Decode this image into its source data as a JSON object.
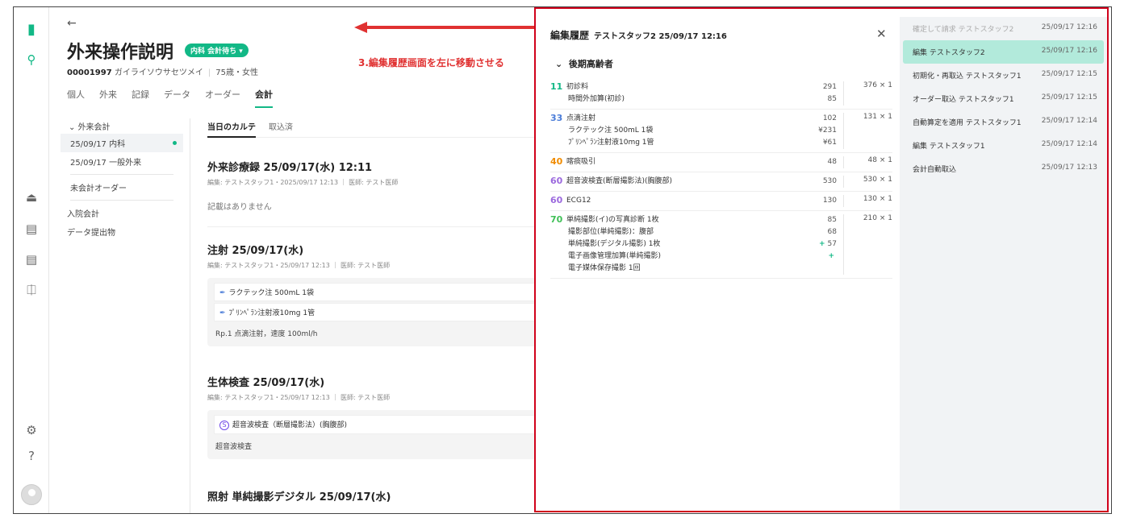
{
  "annotation": "3.編集履歴画面を左に移動させる",
  "patient": {
    "name": "外来操作説明",
    "badge": "内科 会計待ち ▾",
    "id": "00001997",
    "kana": "ガイライソウサセツメイ",
    "age_sex": "75歳・女性"
  },
  "tabs": [
    "個人",
    "外来",
    "記録",
    "データ",
    "オーダー",
    "会計"
  ],
  "subnav": {
    "group": "外来会計",
    "visits": [
      "25/09/17 内科",
      "25/09/17 一般外来"
    ],
    "unpaid": "未会計オーダー",
    "inpatient": "入院会計",
    "submissions": "データ提出物"
  },
  "main": {
    "tabs": [
      "当日のカルテ",
      "取込済"
    ],
    "records": [
      {
        "title": "外来診療録  25/09/17(水) 12:11",
        "meta": "編集: テストスタッフ1・2025/09/17 12:13 ｜ 医師: テスト医師",
        "empty": "記載はありません"
      },
      {
        "title": "注射  25/09/17(水)",
        "meta": "編集: テストスタッフ1・25/09/17 12:13 ｜ 医師: テスト医師",
        "lines": [
          "ラクテック注 500mL  1袋",
          "ﾌﾟﾘﾝﾍﾟﾗﾝ注射液10mg  1管"
        ],
        "rp": "Rp.1  点滴注射，速度 100ml/h"
      },
      {
        "title": "生体検査  25/09/17(水)",
        "meta": "編集: テストスタッフ1・25/09/17 12:13 ｜ 医師: テスト医師",
        "line": "超音波検査（断層撮影法）(胸腹部)",
        "rp": "超音波検査"
      },
      {
        "title": "照射 単純撮影デジタル  25/09/17(水)"
      }
    ]
  },
  "edit_panel": {
    "title": "編集履歴",
    "who": "テストスタッフ2  25/09/17 12:16",
    "group": "後期高齢者",
    "rows": [
      {
        "code": "11",
        "color": "#12b886",
        "items": [
          "初診料",
          "時間外加算(初診)"
        ],
        "points": [
          "291",
          "85"
        ],
        "total": "376 × 1"
      },
      {
        "code": "33",
        "color": "#4a7cd8",
        "items": [
          "点滴注射",
          "ラクテック注 500mL  1袋",
          "ﾌﾟﾘﾝﾍﾟﾗﾝ注射液10mg  1管"
        ],
        "points": [
          "102",
          "¥231",
          "¥61"
        ],
        "total": "131 × 1"
      },
      {
        "code": "40",
        "color": "#f08c00",
        "items": [
          "喀痰吸引"
        ],
        "points": [
          "48"
        ],
        "total": "48 × 1"
      },
      {
        "code": "60",
        "color": "#9c6ade",
        "items": [
          "超音波検査(断層撮影法)(胸腹部)"
        ],
        "points": [
          "530"
        ],
        "total": "530 × 1"
      },
      {
        "code": "60",
        "color": "#9c6ade",
        "items": [
          "ECG12"
        ],
        "points": [
          "130"
        ],
        "total": "130 × 1"
      },
      {
        "code": "70",
        "color": "#40c057",
        "items": [
          "単純撮影(イ)の写真診断  1枚",
          "撮影部位(単純撮影)：腹部",
          "単純撮影(デジタル撮影)  1枚",
          "電子画像管理加算(単純撮影)",
          "電子媒体保存撮影 1回"
        ],
        "points": [
          "85",
          "",
          "68",
          "57",
          ""
        ],
        "total": "210 × 1"
      }
    ]
  },
  "history": [
    {
      "label": "確定して請求  テストスタッフ2",
      "time": "25/09/17 12:16",
      "state": "dim"
    },
    {
      "label": "編集  テストスタッフ2",
      "time": "25/09/17 12:16",
      "state": "active"
    },
    {
      "label": "初期化・再取込  テストスタッフ1",
      "time": "25/09/17 12:15",
      "state": ""
    },
    {
      "label": "オーダー取込  テストスタッフ1",
      "time": "25/09/17 12:15",
      "state": ""
    },
    {
      "label": "自動算定を適用  テストスタッフ1",
      "time": "25/09/17 12:14",
      "state": ""
    },
    {
      "label": "編集  テストスタッフ1",
      "time": "25/09/17 12:14",
      "state": ""
    },
    {
      "label": "会計自動取込",
      "time": "25/09/17 12:13",
      "state": ""
    }
  ]
}
